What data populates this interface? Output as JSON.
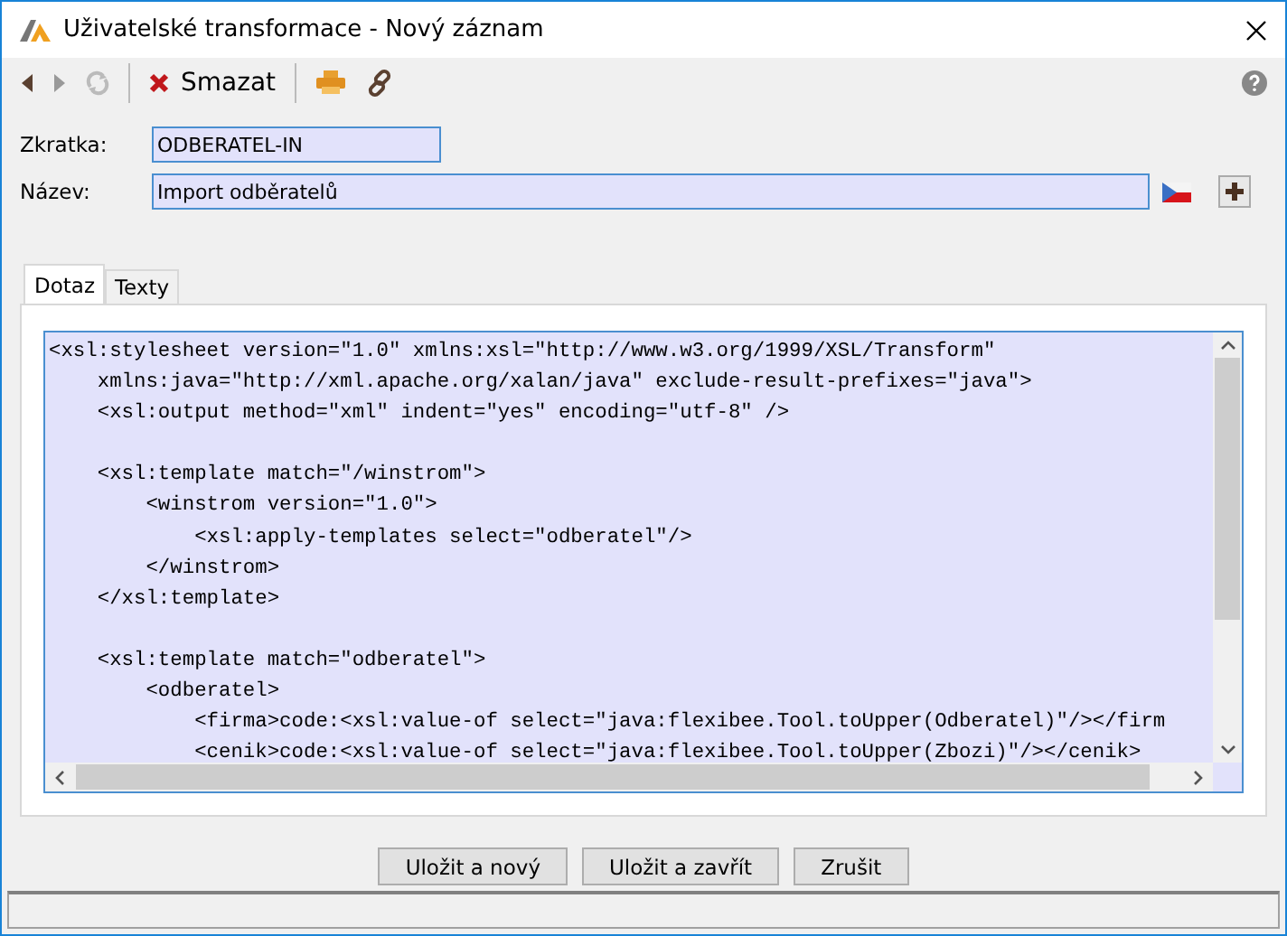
{
  "window": {
    "title": "Uživatelské transformace - Nový záznam"
  },
  "toolbar": {
    "delete_label": "Smazat",
    "refresh_disabled": true
  },
  "fields": [
    {
      "label": "Zkratka:",
      "value": "ODBERATEL-IN",
      "wide": false
    },
    {
      "label": "Název:",
      "value": "Import odběratelů",
      "wide": true
    }
  ],
  "tabs": [
    {
      "label": "Dotaz",
      "selected": true
    },
    {
      "label": "Texty",
      "selected": false
    }
  ],
  "editor": {
    "code": "<xsl:stylesheet version=\"1.0\" xmlns:xsl=\"http://www.w3.org/1999/XSL/Transform\"\n    xmlns:java=\"http://xml.apache.org/xalan/java\" exclude-result-prefixes=\"java\">\n    <xsl:output method=\"xml\" indent=\"yes\" encoding=\"utf-8\" />\n\n    <xsl:template match=\"/winstrom\">\n        <winstrom version=\"1.0\">\n            <xsl:apply-templates select=\"odberatel\"/>\n        </winstrom>\n    </xsl:template>\n\n    <xsl:template match=\"odberatel\">\n        <odberatel>\n            <firma>code:<xsl:value-of select=\"java:flexibee.Tool.toUpper(Odberatel)\"/></firm\n            <cenik>code:<xsl:value-of select=\"java:flexibee.Tool.toUpper(Zbozi)\"/></cenik>"
  },
  "buttons": [
    "Uložit a nový",
    "Uložit a zavřít",
    "Zrušit"
  ]
}
